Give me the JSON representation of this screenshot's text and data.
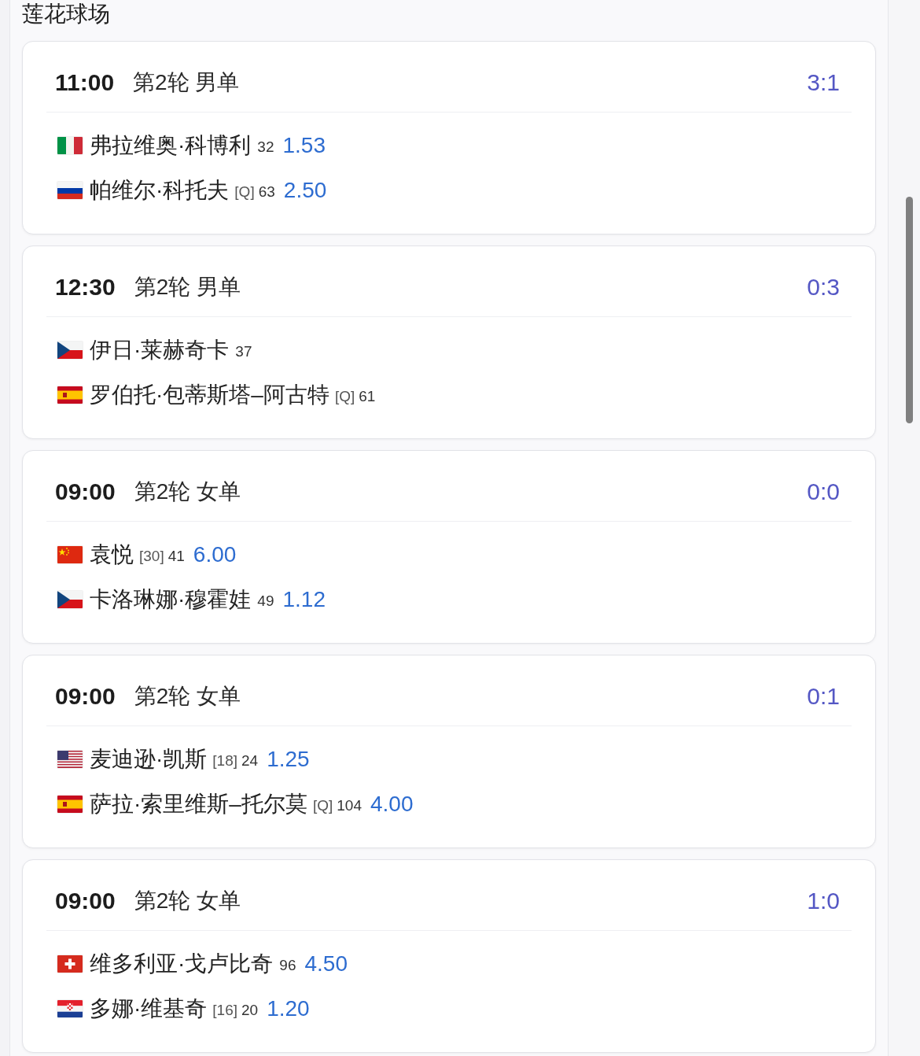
{
  "venue": {
    "title": "莲花球场"
  },
  "matches": [
    {
      "time": "11:00",
      "round": "第2轮 男单",
      "score": "3:1",
      "players": [
        {
          "flag": {
            "kind": "italy"
          },
          "name": "弗拉维奥·科博利",
          "rank": "32",
          "odds": "1.53"
        },
        {
          "flag": {
            "kind": "russia"
          },
          "name": "帕维尔·科托夫",
          "seed": "[Q]",
          "rank": "63",
          "odds": "2.50"
        }
      ]
    },
    {
      "time": "12:30",
      "round": "第2轮 男单",
      "score": "0:3",
      "players": [
        {
          "flag": {
            "kind": "czechia"
          },
          "name": "伊日·莱赫奇卡",
          "rank": "37"
        },
        {
          "flag": {
            "kind": "spain"
          },
          "name": "罗伯托·包蒂斯塔–阿古特",
          "seed": "[Q]",
          "rank": "61"
        }
      ]
    },
    {
      "time": "09:00",
      "round": "第2轮 女单",
      "score": "0:0",
      "players": [
        {
          "flag": {
            "kind": "china"
          },
          "name": "袁悦",
          "seed": "[30]",
          "rank": "41",
          "odds": "6.00"
        },
        {
          "flag": {
            "kind": "czechia"
          },
          "name": "卡洛琳娜·穆霍娃",
          "rank": "49",
          "odds": "1.12"
        }
      ]
    },
    {
      "time": "09:00",
      "round": "第2轮 女单",
      "score": "0:1",
      "players": [
        {
          "flag": {
            "kind": "usa"
          },
          "name": "麦迪逊·凯斯",
          "seed": "[18]",
          "rank": "24",
          "odds": "1.25"
        },
        {
          "flag": {
            "kind": "spain"
          },
          "name": "萨拉·索里维斯–托尔莫",
          "seed": "[Q]",
          "rank": "104",
          "odds": "4.00"
        }
      ]
    },
    {
      "time": "09:00",
      "round": "第2轮 女单",
      "score": "1:0",
      "players": [
        {
          "flag": {
            "kind": "switzerland"
          },
          "name": "维多利亚·戈卢比奇",
          "rank": "96",
          "odds": "4.50"
        },
        {
          "flag": {
            "kind": "croatia"
          },
          "name": "多娜·维基奇",
          "seed": "[16]",
          "rank": "20",
          "odds": "1.20"
        }
      ]
    }
  ]
}
